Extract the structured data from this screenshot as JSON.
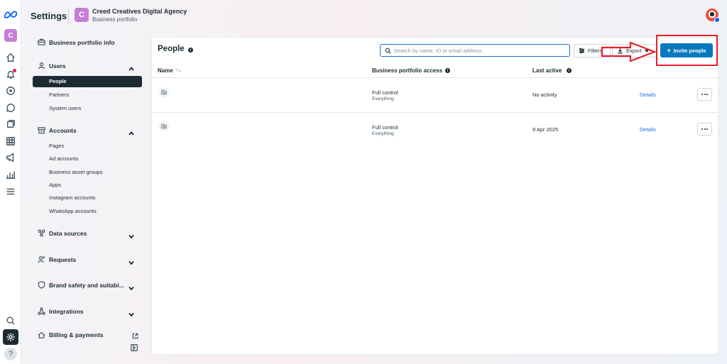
{
  "header": {
    "app_title": "Settings",
    "business_initial": "C",
    "business_name": "Creed Creatives Digital Agency",
    "business_sub": "Business portfolio"
  },
  "rail": {
    "avatar_initial": "C",
    "help": "?"
  },
  "sidebar": {
    "business_portfolio_info": "Business portfolio info",
    "users": {
      "label": "Users",
      "items": [
        "People",
        "Partners",
        "System users"
      ]
    },
    "accounts": {
      "label": "Accounts",
      "items": [
        "Pages",
        "Ad accounts",
        "Business asset groups",
        "Apps",
        "Instagram accounts",
        "WhatsApp accounts"
      ]
    },
    "data_sources": "Data sources",
    "requests": "Requests",
    "brand_safety": "Brand safety and suitabi...",
    "integrations": "Integrations",
    "billing": "Billing & payments"
  },
  "main": {
    "title": "People",
    "search_placeholder": "Search by name, ID or email address",
    "filters_label": "Filters",
    "export_label": "Export",
    "invite_label": "Invite people",
    "columns": {
      "name": "Name",
      "access": "Business portfolio access",
      "last_active": "Last active"
    },
    "rows": [
      {
        "access": "Full control",
        "access_sub": "Everything",
        "last_active": "No activity",
        "details": "Details"
      },
      {
        "access": "Full control",
        "access_sub": "Everything",
        "last_active": "9 Apr 2025",
        "details": "Details"
      }
    ]
  },
  "colors": {
    "accent": "#0a78be",
    "link": "#1d6ad8",
    "annotation": "#e8202a",
    "brand": "#0866ff"
  }
}
